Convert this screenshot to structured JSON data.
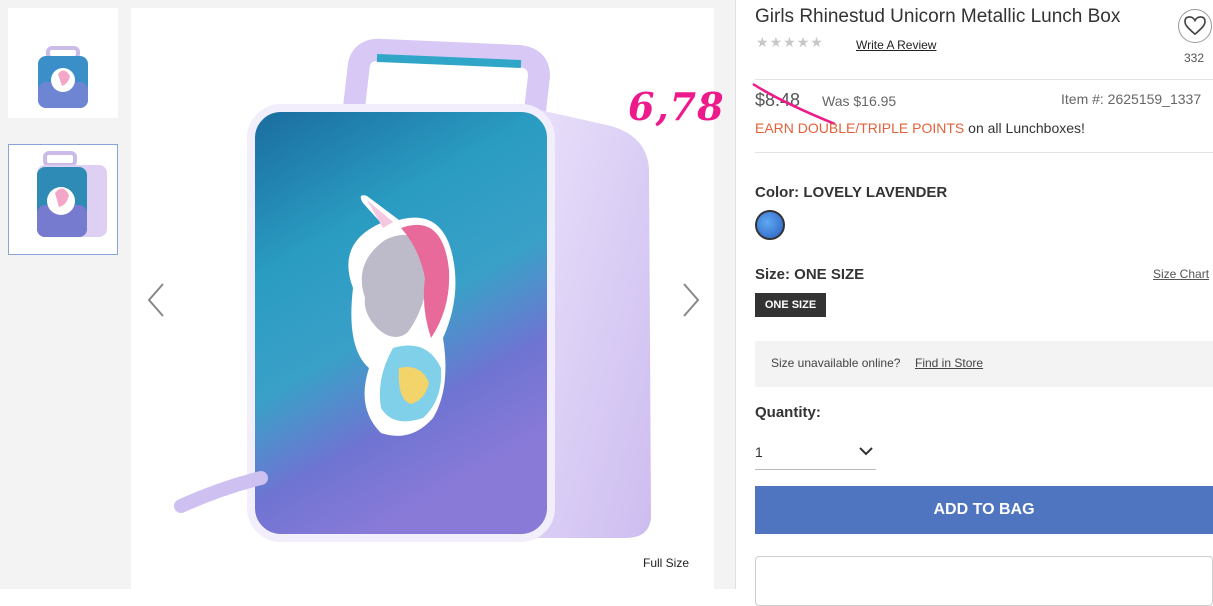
{
  "product": {
    "title": "Girls Rhinestud Unicorn Metallic Lunch Box",
    "write_review": "Write A Review",
    "favorites_count": "332",
    "price": "$8.48",
    "was_price": "Was $16.95",
    "item_number": "Item #: 2625159_1337",
    "annotation": "6,78",
    "promo_highlight": "EARN DOUBLE/TRIPLE POINTS",
    "promo_rest": " on all Lunchboxes!",
    "color_label": "Color: ",
    "color_value": "LOVELY LAVENDER",
    "size_label": "Size: ONE SIZE",
    "size_chart": "Size Chart",
    "size_option": "ONE SIZE",
    "store_text": "Size unavailable online?",
    "find_in_store": "Find in Store",
    "quantity_label": "Quantity:",
    "quantity_value": "1",
    "add_to_bag": "ADD TO BAG",
    "full_size": "Full Size"
  },
  "icons": {
    "favorite": "heart-icon",
    "prev": "chevron-left-icon",
    "next": "chevron-right-icon",
    "qty": "chevron-down-icon"
  },
  "colors": {
    "accent_button": "#4f74c0",
    "promo": "#e2623b",
    "annotation": "#ee1a8b"
  }
}
